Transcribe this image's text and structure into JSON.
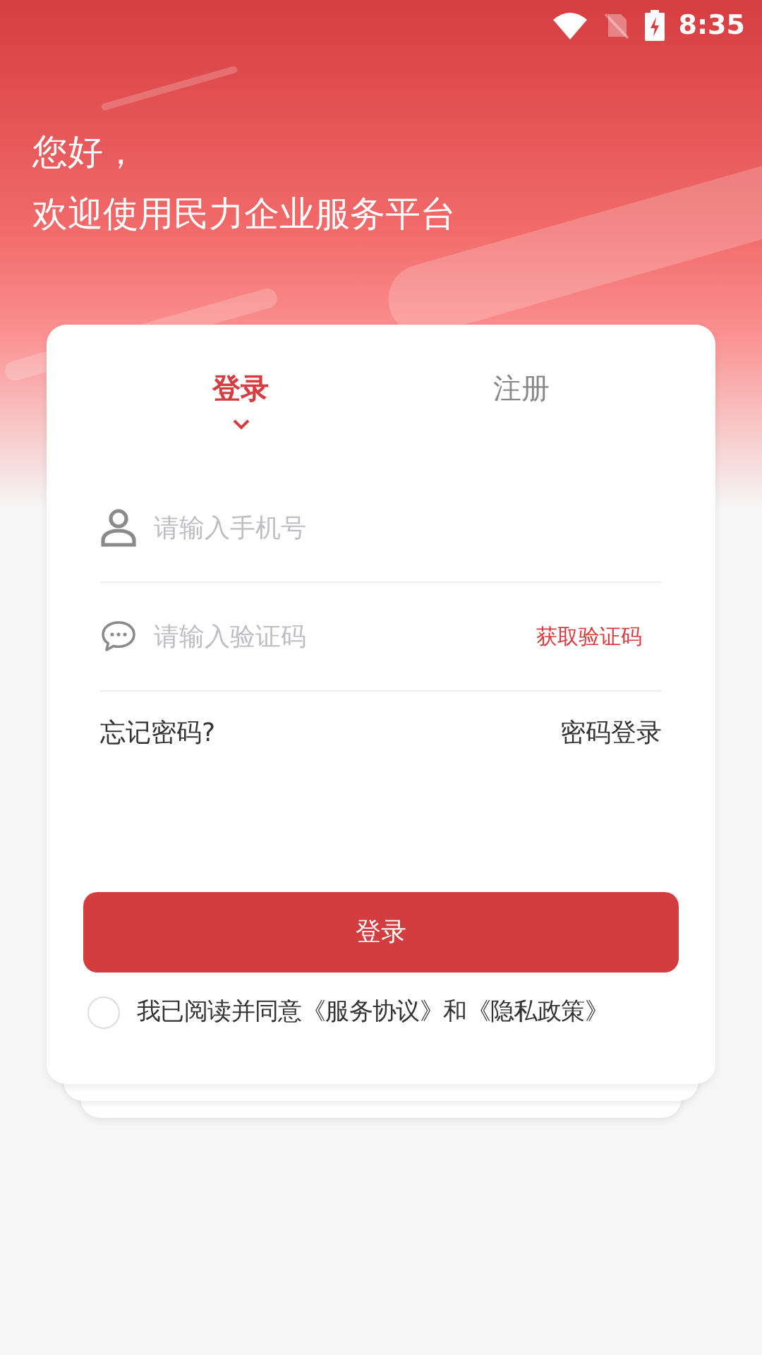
{
  "status_bar": {
    "time": "8:35"
  },
  "greeting": {
    "line_1": "您好，",
    "line_2": "欢迎使用民力企业服务平台"
  },
  "tabs": [
    {
      "label": "登录",
      "selected": true
    },
    {
      "label": "注册",
      "selected": false
    }
  ],
  "fields": [
    {
      "kind": "phone",
      "placeholder": "请输入手机号"
    },
    {
      "kind": "code",
      "placeholder": "请输入验证码",
      "action": "获取验证码"
    }
  ],
  "links": {
    "forgot": "忘记密码?",
    "password_login": "密码登录"
  },
  "login_button": "登录",
  "agreement": {
    "checked": false,
    "text": "我已阅读并同意《服务协议》和《隐私政策》"
  }
}
